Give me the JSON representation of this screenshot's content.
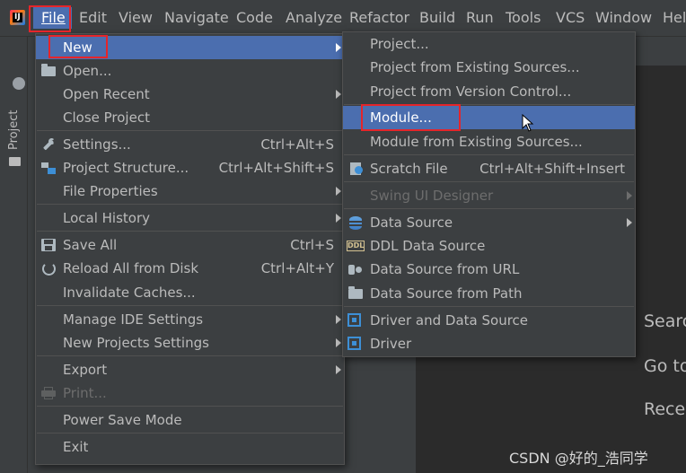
{
  "menubar": {
    "items": [
      "File",
      "Edit",
      "View",
      "Navigate",
      "Code",
      "Analyze",
      "Refactor",
      "Build",
      "Run",
      "Tools",
      "VCS",
      "Window",
      "Help"
    ],
    "visible_text": [
      "File",
      "Edit",
      "View",
      "Navigate",
      "Code",
      "Analyze",
      "Refactor",
      "Build",
      "Run",
      "Tools",
      "VCS",
      "Window",
      "Hel"
    ]
  },
  "sidebar": {
    "project_label": "Project"
  },
  "file_menu": {
    "items": [
      {
        "label": "New",
        "mnemonic": "N",
        "submenu": true,
        "selected": true
      },
      {
        "label": "Open...",
        "icon": "folder-open-icon"
      },
      {
        "label": "Open Recent",
        "submenu": true
      },
      {
        "label": "Close Project"
      },
      {
        "label": "Settings...",
        "shortcut": "Ctrl+Alt+S",
        "icon": "wrench-icon"
      },
      {
        "label": "Project Structure...",
        "shortcut": "Ctrl+Alt+Shift+S",
        "icon": "project-structure-icon"
      },
      {
        "label": "File Properties",
        "submenu": true
      },
      {
        "label": "Local History",
        "submenu": true
      },
      {
        "label": "Save All",
        "shortcut": "Ctrl+S",
        "icon": "save-icon"
      },
      {
        "label": "Reload All from Disk",
        "shortcut": "Ctrl+Alt+Y",
        "icon": "reload-icon"
      },
      {
        "label": "Invalidate Caches..."
      },
      {
        "label": "Manage IDE Settings",
        "submenu": true
      },
      {
        "label": "New Projects Settings",
        "submenu": true
      },
      {
        "label": "Export",
        "submenu": true
      },
      {
        "label": "Print...",
        "disabled": true,
        "icon": "print-icon"
      },
      {
        "label": "Power Save Mode"
      },
      {
        "label": "Exit"
      }
    ]
  },
  "new_menu": {
    "items": [
      {
        "label": "Project..."
      },
      {
        "label": "Project from Existing Sources..."
      },
      {
        "label": "Project from Version Control..."
      },
      {
        "label": "Module...",
        "selected": true
      },
      {
        "label": "Module from Existing Sources..."
      },
      {
        "label": "Scratch File",
        "shortcut": "Ctrl+Alt+Shift+Insert",
        "icon": "scratch-file-icon"
      },
      {
        "label": "Swing UI Designer",
        "disabled": true,
        "submenu": true
      },
      {
        "label": "Data Source",
        "submenu": true,
        "icon": "database-icon"
      },
      {
        "label": "DDL Data Source",
        "icon": "ddl-icon",
        "icon_text": "DDL"
      },
      {
        "label": "Data Source from URL",
        "icon": "url-plug-icon"
      },
      {
        "label": "Data Source from Path",
        "icon": "folder-icon"
      },
      {
        "label": "Driver and Data Source",
        "icon": "driver-icon"
      },
      {
        "label": "Driver",
        "icon": "driver-icon"
      }
    ]
  },
  "welcome_panel": {
    "lines": [
      "Searc",
      "Go to",
      "Recen"
    ]
  },
  "watermark": "CSDN @好的_浩同学",
  "colors": {
    "menu_bg": "#3c3f41",
    "selection": "#4b6eaf",
    "highlight_box": "#e5252a",
    "text": "#bbbbbb",
    "disabled_text": "#6d6d6d"
  }
}
